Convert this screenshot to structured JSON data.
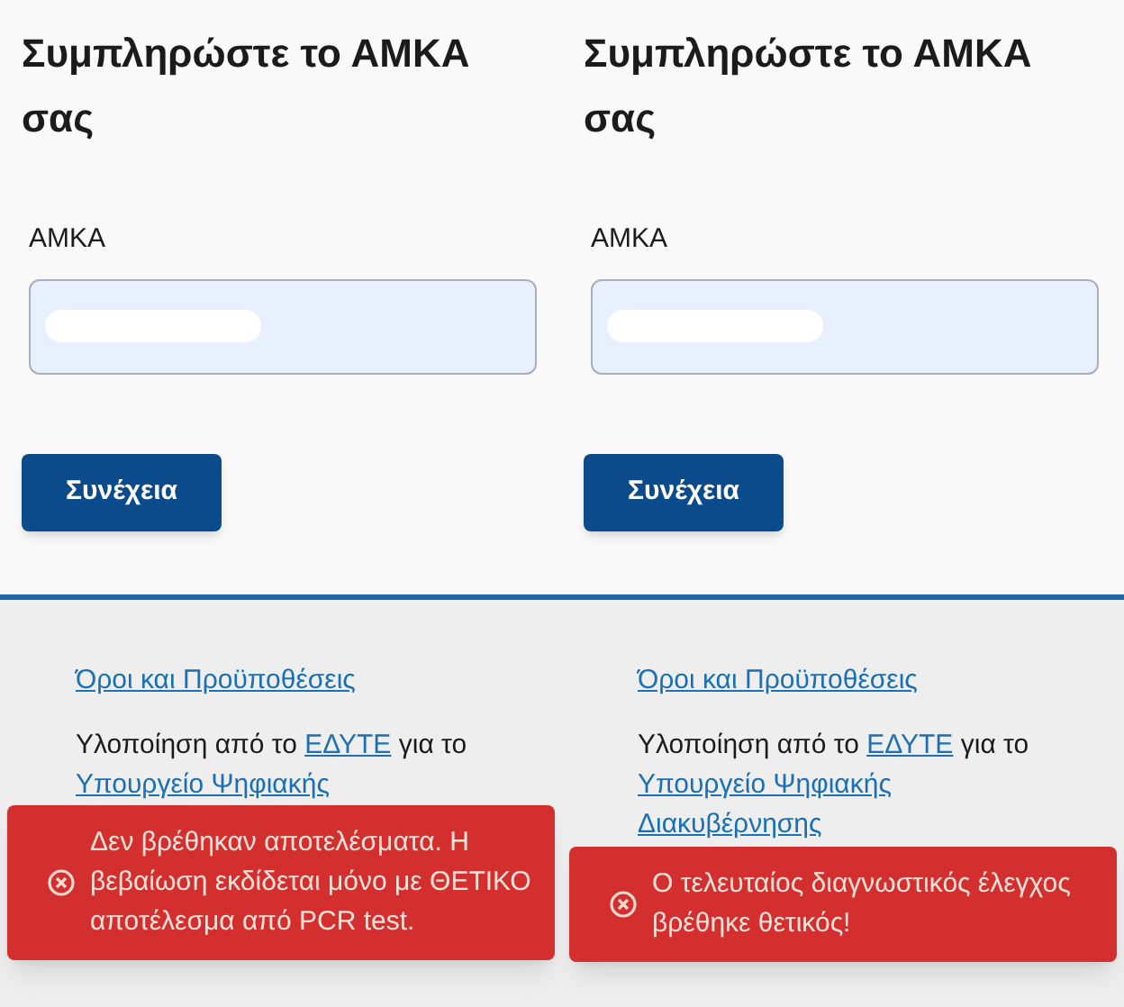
{
  "panels": [
    {
      "heading": "Συμπληρώστε το ΑΜΚΑ σας",
      "field": {
        "label": "ΑΜΚΑ",
        "value_redacted": true
      },
      "continue_button": "Συνέχεια",
      "footer": {
        "terms_link": "Όροι και Προϋποθέσεις",
        "credit_prefix": "Υλοποίηση από το ",
        "edyte_link": "ΕΔΥΤΕ",
        "credit_middle": " για το",
        "ministry_link_lines": [
          "Υπουργείο Ψηφιακής"
        ]
      },
      "toast": {
        "kind": "error",
        "message": "Δεν βρέθηκαν αποτελέσματα. Η βεβαίωση εκδίδεται μόνο με ΘΕΤΙΚΟ αποτέλεσμα από PCR test."
      }
    },
    {
      "heading": "Συμπληρώστε το ΑΜΚΑ σας",
      "field": {
        "label": "ΑΜΚΑ",
        "value_redacted": true
      },
      "continue_button": "Συνέχεια",
      "footer": {
        "terms_link": "Όροι και Προϋποθέσεις",
        "credit_prefix": "Υλοποίηση από το ",
        "edyte_link": "ΕΔΥΤΕ",
        "credit_middle": " για το",
        "ministry_link_lines": [
          "Υπουργείο Ψηφιακής",
          "Διακυβέρνησης"
        ]
      },
      "toast": {
        "kind": "error",
        "message": "Ο τελευταίος διαγνωστικός έλεγχος βρέθηκε θετικός!"
      }
    }
  ]
}
